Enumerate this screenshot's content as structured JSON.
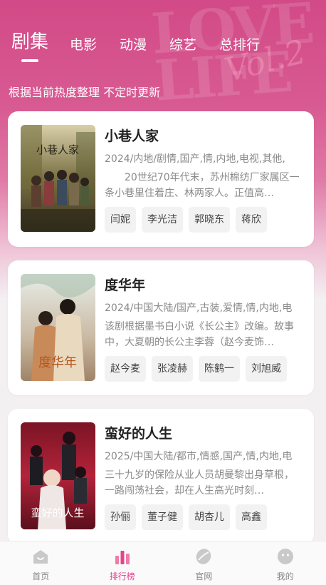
{
  "tabs": [
    {
      "label": "剧集"
    },
    {
      "label": "电影"
    },
    {
      "label": "动漫"
    },
    {
      "label": "综艺"
    },
    {
      "label": "总排行"
    }
  ],
  "subtitle": "根据当前热度整理 不定时更新",
  "shows": [
    {
      "title": "小巷人家",
      "meta": "2024/内地/剧情,国产,情,内地,电视,其他,",
      "desc": "20世纪70年代末，苏州棉纺厂家属区一条小巷里住着庄、林两家人。正值高…",
      "actors": [
        "闫妮",
        "李光洁",
        "郭晓东",
        "蒋欣"
      ]
    },
    {
      "title": "度华年",
      "meta": "2024/中国大陆/国产,古装,爱情,情,内地,电",
      "desc": "该剧根据墨书白小说《长公主》改编。故事中，大夏朝的长公主李蓉（赵今麦饰…",
      "actors": [
        "赵今麦",
        "张凌赫",
        "陈鹤一",
        "刘旭威"
      ]
    },
    {
      "title": "蛮好的人生",
      "meta": "2025/中国大陆/都市,情感,国产,情,内地,电",
      "desc": "三十九岁的保险从业人员胡曼黎出身草根，一路闯荡社会，却在人生高光时刻…",
      "actors": [
        "孙俪",
        "董子健",
        "胡杏儿",
        "高鑫"
      ]
    }
  ],
  "nav": [
    {
      "label": "首页",
      "icon": "home-icon"
    },
    {
      "label": "排行榜",
      "icon": "ranking-icon"
    },
    {
      "label": "官网",
      "icon": "website-icon"
    },
    {
      "label": "我的",
      "icon": "profile-icon"
    }
  ],
  "colors": {
    "accent": "#e0478a",
    "hero": "#d24a87"
  }
}
